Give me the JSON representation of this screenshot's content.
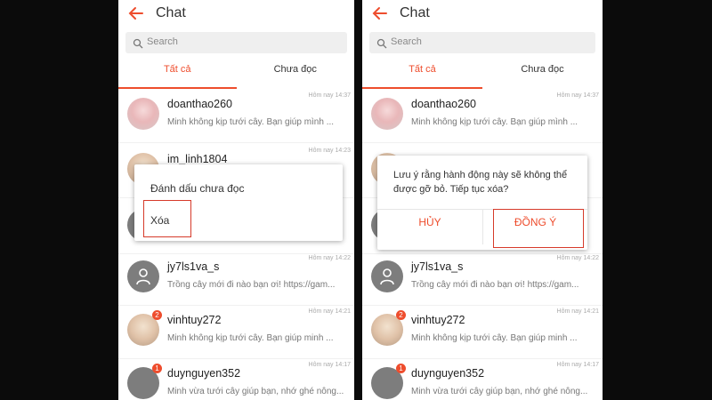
{
  "header": {
    "title": "Chat"
  },
  "search": {
    "placeholder": "Search"
  },
  "tabs": {
    "all": "Tất cả",
    "unread": "Chưa đọc"
  },
  "chats": [
    {
      "name": "doanthao260",
      "preview": "Minh không kịp tưới cây. Bạn giúp mình ...",
      "time": "Hôm nay 14:37"
    },
    {
      "name": "im_linh1804",
      "preview": "",
      "time": "Hôm nay 14:23"
    },
    {
      "name": "jy7ls1va_s",
      "preview": "Trồng cây mới đi nào bạn ơi! https://gam...",
      "time": "Hôm nay 14:22"
    },
    {
      "name": "vinhtuy272",
      "preview": "Minh không kịp tưới cây. Bạn giúp minh ...",
      "time": "Hôm nay 14:21",
      "badge": "2"
    },
    {
      "name": "duynguyen352",
      "preview": "Minh vừa tưới cây giúp bạn, nhớ ghé nông...",
      "time": "Hôm nay 14:17",
      "badge": "1"
    }
  ],
  "menu_popup": {
    "mark_unread": "Đánh dấu chưa đọc",
    "delete": "Xóa"
  },
  "confirm_dialog": {
    "message": "Lưu ý rằng hành động này sẽ không thể được gỡ bỏ. Tiếp tục xóa?",
    "cancel": "HỦY",
    "confirm": "ĐỒNG Ý"
  },
  "colors": {
    "accent": "#ee4d2d",
    "highlight_box": "#d63a2a",
    "backdrop": "#0b0b0b"
  }
}
